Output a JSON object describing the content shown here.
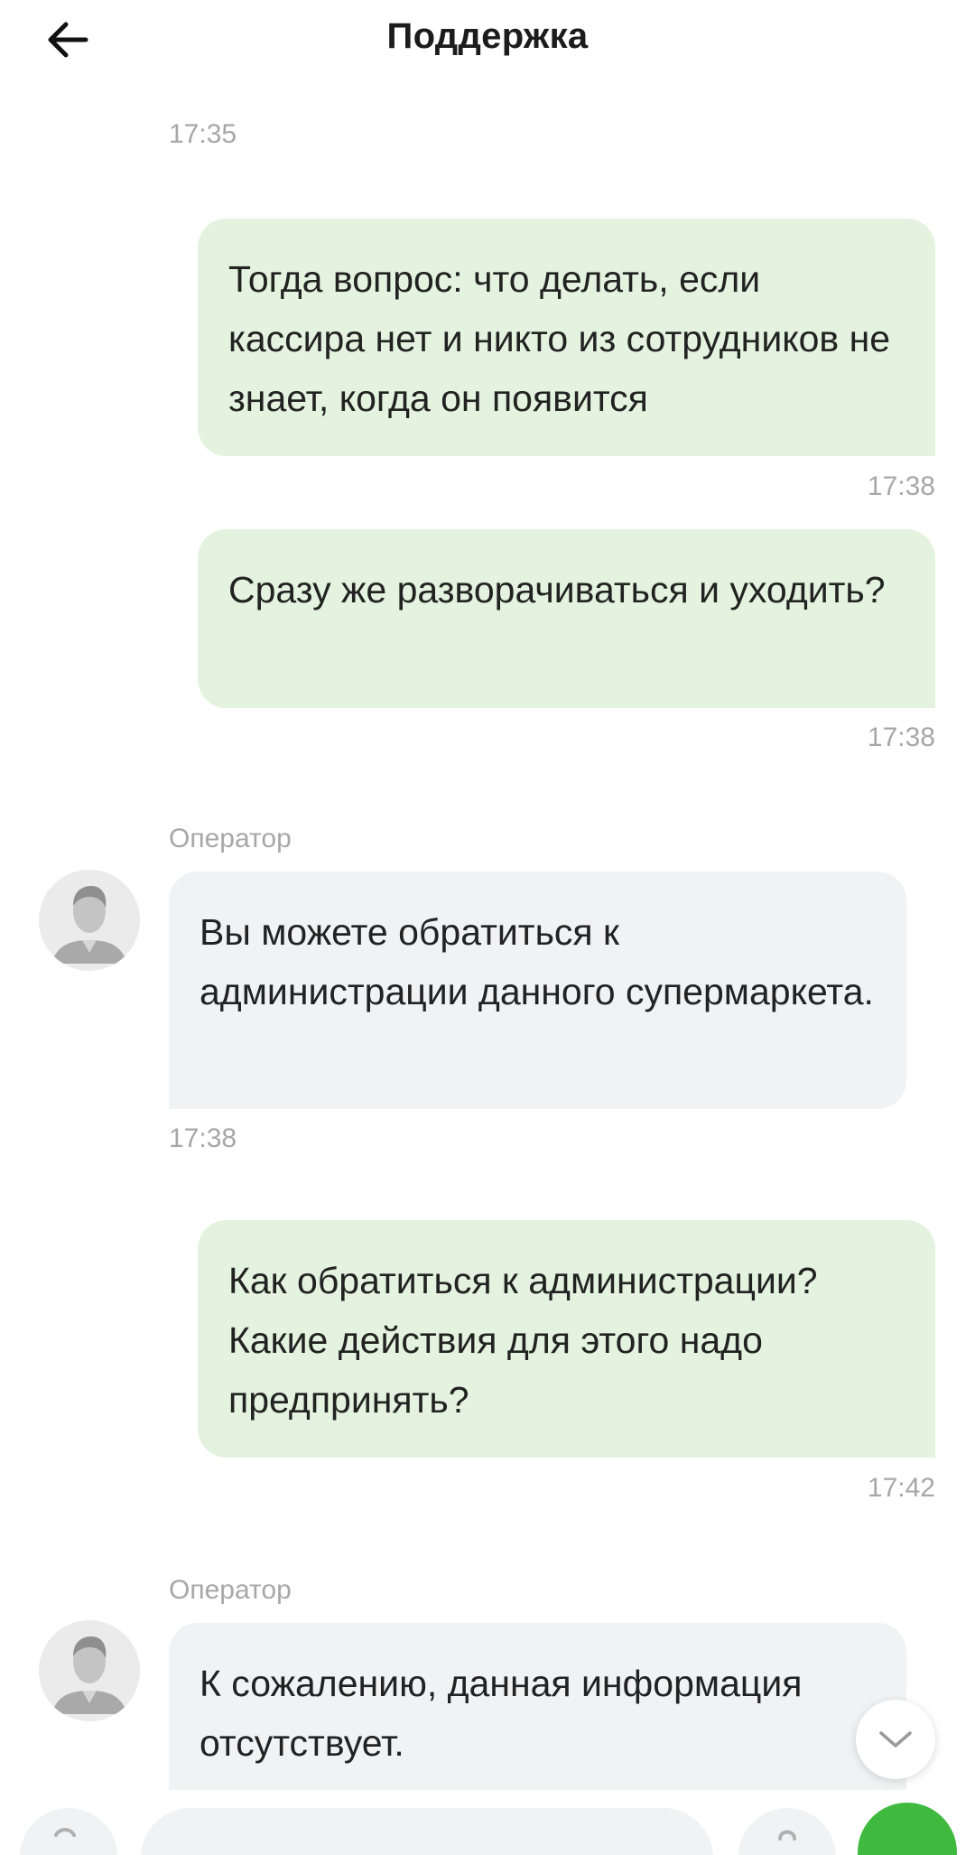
{
  "header": {
    "title": "Поддержка",
    "back_icon": "arrow-left-icon"
  },
  "messages": [
    {
      "type": "time",
      "text": "17:35"
    },
    {
      "type": "out",
      "text": "Тогда вопрос: что делать, если кассира нет и никто из сотрудников не знает, когда он появится",
      "time": "17:38"
    },
    {
      "type": "out",
      "text": "Сразу же разворачиваться и уходить?",
      "time": "17:38"
    },
    {
      "type": "in",
      "sender": "Оператор",
      "text": "Вы можете обратиться к администрации данного супермаркета.",
      "time": "17:38"
    },
    {
      "type": "out",
      "text": "Как обратиться к администрации? Какие действия для этого надо предпринять?",
      "time": "17:42"
    },
    {
      "type": "in",
      "sender": "Оператор",
      "text": "К сожалению, данная информация отсутствует."
    }
  ],
  "controls": {
    "scroll_down_icon": "chevron-down-icon",
    "attach_icon": "attach-icon",
    "mic_icon": "microphone-icon",
    "send_icon": "send-icon"
  },
  "colors": {
    "outgoing_bubble": "#e4f3df",
    "incoming_bubble": "#f1f2f4",
    "accent": "#3fba3f"
  }
}
